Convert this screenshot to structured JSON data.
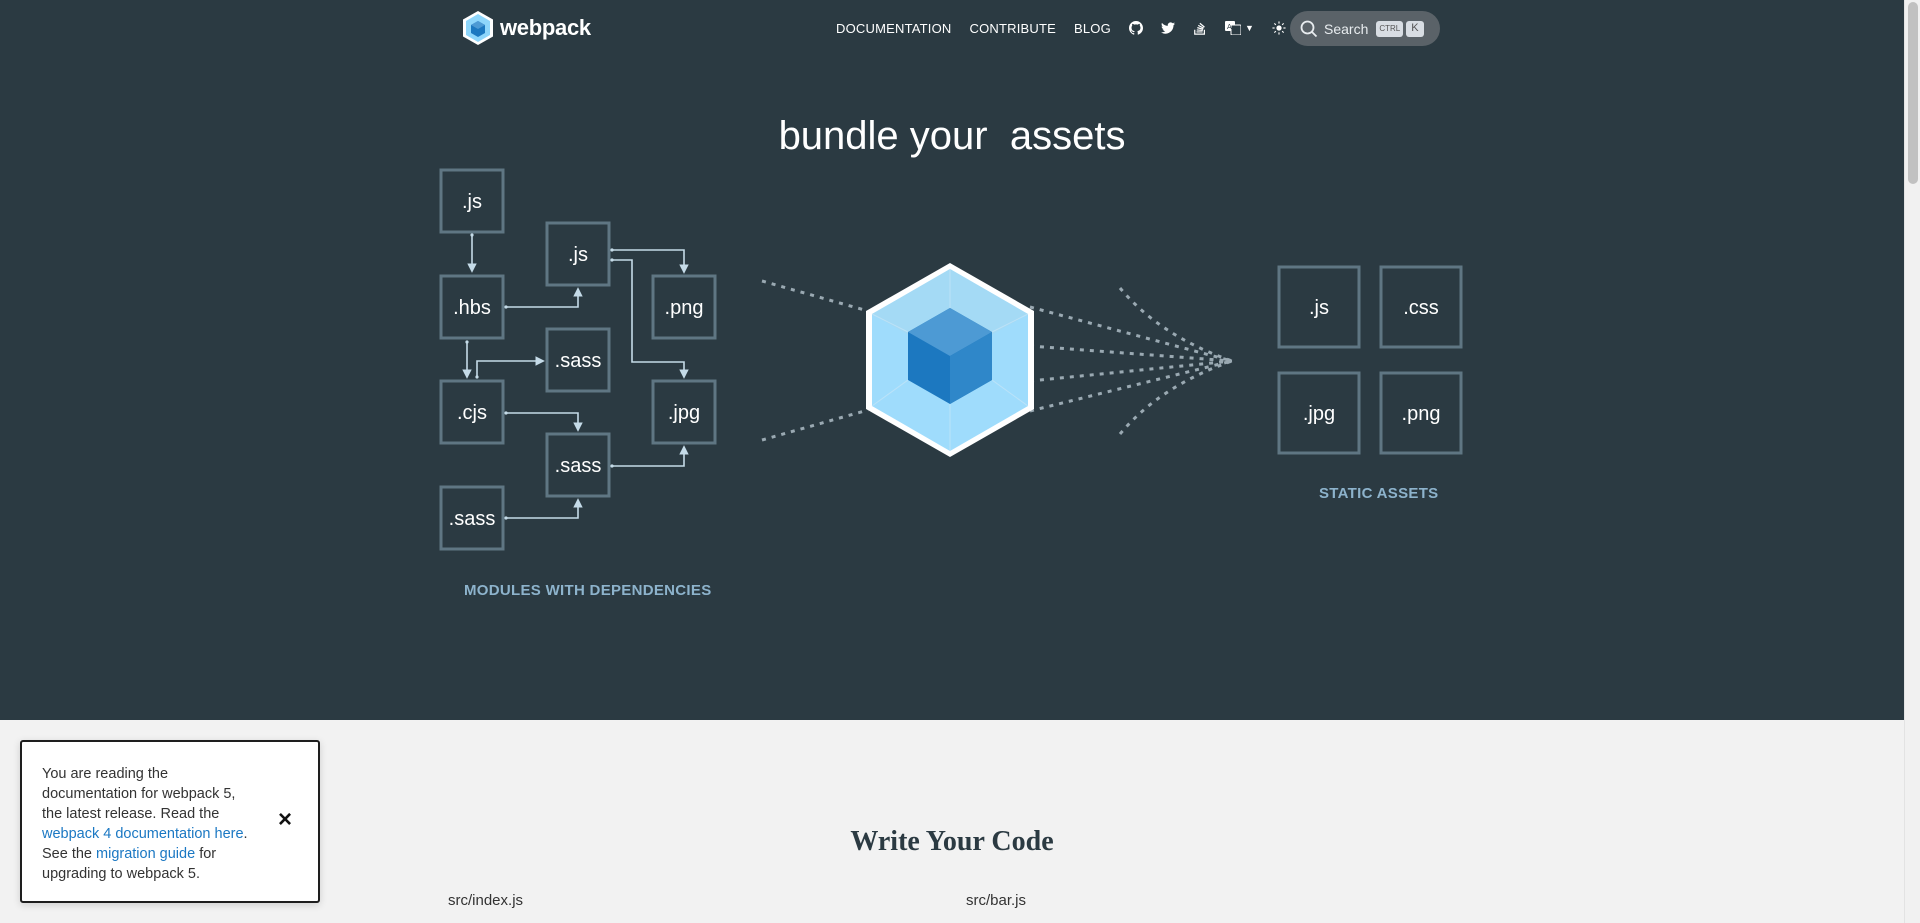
{
  "header": {
    "logo_text": "webpack",
    "nav": [
      {
        "label": "DOCUMENTATION"
      },
      {
        "label": "CONTRIBUTE"
      },
      {
        "label": "BLOG"
      }
    ],
    "icons": [
      "github-icon",
      "twitter-icon",
      "stack-overflow-icon",
      "language-icon",
      "theme-icon"
    ],
    "search": {
      "label": "Search",
      "kbd_ctrl": "CTRL",
      "kbd_k": "K"
    }
  },
  "hero": {
    "title": "bundle your  assets",
    "modules_caption": "MODULES WITH DEPENDENCIES",
    "assets_caption": "STATIC ASSETS",
    "modules": [
      ".js",
      ".js",
      ".png",
      ".hbs",
      ".sass",
      ".cjs",
      ".jpg",
      ".sass",
      ".sass"
    ],
    "assets": [
      ".js",
      ".css",
      ".jpg",
      ".png"
    ]
  },
  "notice": {
    "text_1": "You are reading the documentation for webpack 5, the latest release. Read the ",
    "link_1": "webpack 4 documentation here",
    "text_2": ". See the ",
    "link_2": "migration guide",
    "text_3": " for upgrading to webpack 5.",
    "close": "×"
  },
  "content": {
    "section_title": "Write Your Code",
    "file_1": "src/index.js",
    "file_2": "src/bar.js"
  },
  "colors": {
    "bg_dark": "#2b3a42",
    "box_border": "#5f7683",
    "caption": "#8db3cc",
    "cube_light": "#8ed6fb",
    "cube_dark": "#1c78c0"
  }
}
